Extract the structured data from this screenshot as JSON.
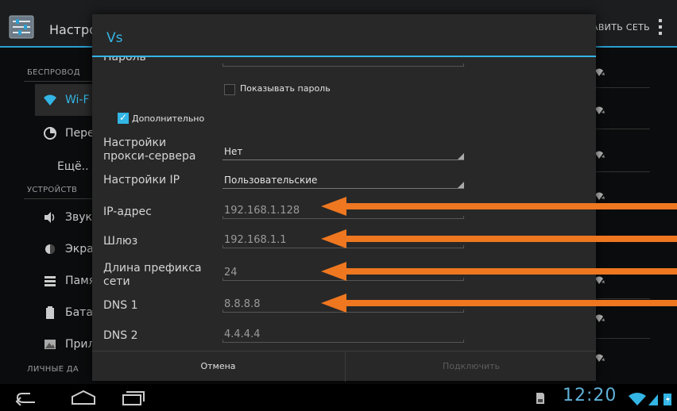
{
  "background": {
    "title": "Настрой",
    "right_action": "АВИТЬ СЕТЬ",
    "sections": [
      {
        "header": "БЕСПРОВОД"
      },
      {
        "header": "УСТРОЙСТВ"
      },
      {
        "header": "ЛИЧНЫЕ ДА"
      }
    ],
    "items": [
      {
        "label": "Wi-F",
        "icon": "wifi-icon"
      },
      {
        "label": "Пере",
        "icon": "data-usage-icon"
      },
      {
        "label": "Ещё..",
        "icon": ""
      },
      {
        "label": "Звук",
        "icon": "sound-icon"
      },
      {
        "label": "Экра",
        "icon": "display-icon"
      },
      {
        "label": "Памя",
        "icon": "storage-icon"
      },
      {
        "label": "Бата",
        "icon": "battery-icon"
      },
      {
        "label": "Прил",
        "icon": "apps-icon"
      }
    ]
  },
  "dialog": {
    "title": "Vs",
    "password_label": "Пароль",
    "show_password_label": "Показывать пароль",
    "advanced_label": "Дополнительно",
    "fields": {
      "proxy_label": "Настройки прокси-сервера",
      "proxy_value": "Нет",
      "ip_settings_label": "Настройки IP",
      "ip_settings_value": "Пользовательские",
      "ip_label": "IP-адрес",
      "ip_value": "192.168.1.128",
      "gateway_label": "Шлюз",
      "gateway_value": "192.168.1.1",
      "prefix_label": "Длина префикса сети",
      "prefix_value": "24",
      "dns1_label": "DNS 1",
      "dns1_value": "8.8.8.8",
      "dns2_label": "DNS 2",
      "dns2_value": "4.4.4.4"
    },
    "buttons": {
      "cancel": "Отмена",
      "connect": "Подключить"
    }
  },
  "statusbar": {
    "time": "12:20"
  },
  "colors": {
    "accent": "#33b5e5",
    "arrow": "#ee7720"
  }
}
